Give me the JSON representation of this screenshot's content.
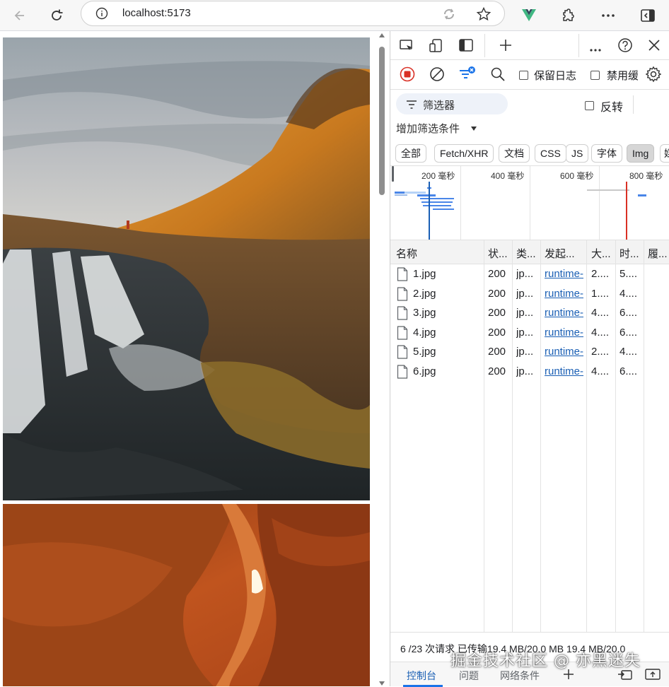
{
  "browser": {
    "url": "localhost:5173"
  },
  "devtools": {
    "toolbar": {
      "preserve_log_label": "保留日志",
      "disable_cache_label": "禁用缓"
    },
    "filter": {
      "placeholder": "筛选器",
      "invert_label": "反转",
      "add_filter_label": "增加筛选条件"
    },
    "type_filters": [
      "全部",
      "Fetch/XHR",
      "文档",
      "CSS",
      "JS",
      "字体",
      "Img",
      "媒"
    ],
    "active_type_filter": "Img",
    "overview": {
      "ticks": [
        "200 毫秒",
        "400 毫秒",
        "600 毫秒",
        "800 毫秒"
      ]
    },
    "table": {
      "headers": [
        "名称",
        "状...",
        "类...",
        "发起...",
        "大...",
        "时...",
        "履..."
      ],
      "rows": [
        {
          "name": "1.jpg",
          "status": "200",
          "type": "jp...",
          "initiator": "runtime-",
          "size": "2....",
          "time": "5...."
        },
        {
          "name": "2.jpg",
          "status": "200",
          "type": "jp...",
          "initiator": "runtime-",
          "size": "1....",
          "time": "4...."
        },
        {
          "name": "3.jpg",
          "status": "200",
          "type": "jp...",
          "initiator": "runtime-",
          "size": "4....",
          "time": "6...."
        },
        {
          "name": "4.jpg",
          "status": "200",
          "type": "jp...",
          "initiator": "runtime-",
          "size": "4....",
          "time": "6...."
        },
        {
          "name": "5.jpg",
          "status": "200",
          "type": "jp...",
          "initiator": "runtime-",
          "size": "2....",
          "time": "4...."
        },
        {
          "name": "6.jpg",
          "status": "200",
          "type": "jp...",
          "initiator": "runtime-",
          "size": "4....",
          "time": "6...."
        }
      ]
    },
    "status": "6 /23 次请求  已传输19.4 MB/20.0 MB  19.4 MB/20.0",
    "drawer_tabs": [
      "控制台",
      "问题",
      "网络条件"
    ],
    "active_drawer_tab": "控制台"
  },
  "watermark": "掘金技术社区 @ 亦黑迷失",
  "colors": {
    "record_red": "#d93025",
    "link_blue": "#1a5fb4",
    "accent_blue": "#1a73e8"
  }
}
